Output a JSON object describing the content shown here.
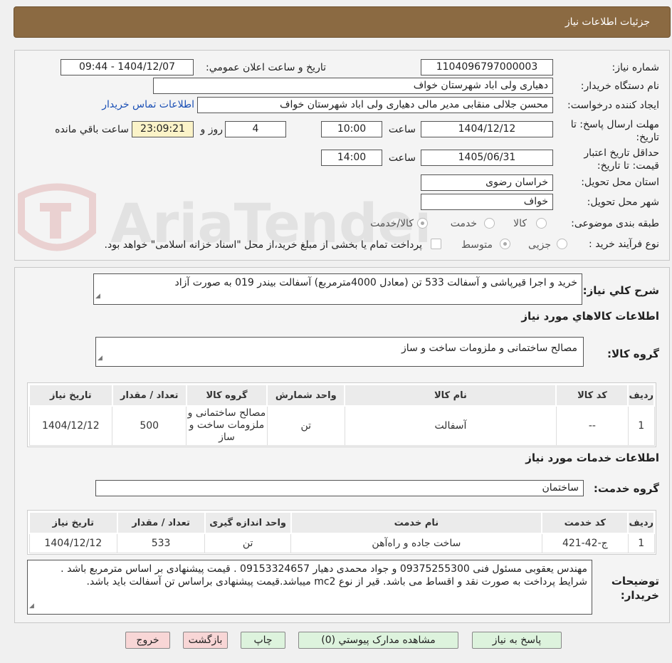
{
  "header": {
    "title": "جزئیات اطلاعات نیاز"
  },
  "watermark": {
    "text": "AriaTender.neT"
  },
  "info": {
    "need_number_label": "شماره نیاز:",
    "need_number": "1104096797000003",
    "announce_label": "تاریخ و ساعت اعلان عمومي:",
    "announce_value": "1404/12/07 - 09:44",
    "buyer_label": "نام دستگاه خريدار:",
    "buyer_value": "دهیاری ولی اباد شهرستان خواف",
    "creator_label": "ایجاد کننده درخواست:",
    "creator_value": "محسن جلالی منقابی مدیر مالی دهیاری ولی اباد شهرستان خواف",
    "contact_link": "اطلاعات تماس خریدار",
    "deadline_label": "مهلت ارسال پاسخ: تا تاریخ:",
    "deadline_date": "1404/12/12",
    "time_label": "ساعت",
    "deadline_time": "10:00",
    "days_value": "4",
    "days_label": "روز و",
    "remaining_time": "23:09:21",
    "remaining_label": "ساعت باقي مانده",
    "validity_label": "حداقل تاريخ اعتبار قيمت: تا تاريخ:",
    "validity_date": "1405/06/31",
    "validity_time": "14:00",
    "province_label": "استان محل تحويل:",
    "province_value": "خراسان رضوی",
    "city_label": "شهر محل تحويل:",
    "city_value": "خواف",
    "category_label": "طبقه بندی موضوعی:",
    "category_options": [
      "کالا",
      "خدمت",
      "کالا/خدمت"
    ],
    "category_selected": "کالا/خدمت",
    "process_label": "نوع فرآیند خرید :",
    "process_options": [
      "جزیی",
      "متوسط"
    ],
    "process_selected": "متوسط",
    "treasury_note": "پرداخت تمام یا بخشی از مبلغ خرید،از محل \"اسناد خزانه اسلامی\" خواهد بود."
  },
  "description": {
    "label": "شرح کلي نياز:",
    "value": "خرید و اجرا قیرپاشی و آسفالت 533 تن (معادل 4000مترمربع) آسفالت بیندر 019 به صورت آزاد"
  },
  "goods": {
    "section_title": "اطلاعات کالاهاي مورد نياز",
    "group_label": "گروه کالا:",
    "group_value": "مصالح ساختمانی و ملزومات ساخت و ساز",
    "columns": [
      "رديف",
      "کد کالا",
      "نام کالا",
      "واحد شمارش",
      "گروه کالا",
      "تعداد / مقدار",
      "تاريخ نياز"
    ],
    "rows": [
      [
        "1",
        "--",
        "آسفالت",
        "تن",
        "مصالح ساختمانی و ملزومات ساخت و ساز",
        "500",
        "1404/12/12"
      ]
    ]
  },
  "services": {
    "section_title": "اطلاعات خدمات مورد نياز",
    "group_label": "گروه خدمت:",
    "group_value": "ساختمان",
    "columns": [
      "رديف",
      "کد خدمت",
      "نام خدمت",
      "واحد اندازه گيری",
      "تعداد / مقدار",
      "تاريخ نياز"
    ],
    "rows": [
      [
        "1",
        "ج-42-421",
        "ساخت جاده و راه‌آهن",
        "تن",
        "533",
        "1404/12/12"
      ]
    ]
  },
  "buyer_notes": {
    "label": "توضيحات خريدار:",
    "value": "مهندس یعقوبی مسئول فنی 09375255300 و جواد محمدی دهیار 09153324657 . قیمت پیشنهادی بر اساس مترمربع باشد . شرایط پرداخت به صورت نقد و اقساط می باشد. قیر از نوع mc2 میباشد.قیمت پیشنهادی براساس تن آسفالت باید باشد."
  },
  "buttons": {
    "reply": "پاسخ به نیاز",
    "attachments": "مشاهده مدارک پيوستي (0)",
    "print": "چاپ",
    "back": "بازگشت",
    "exit": "خروج"
  }
}
